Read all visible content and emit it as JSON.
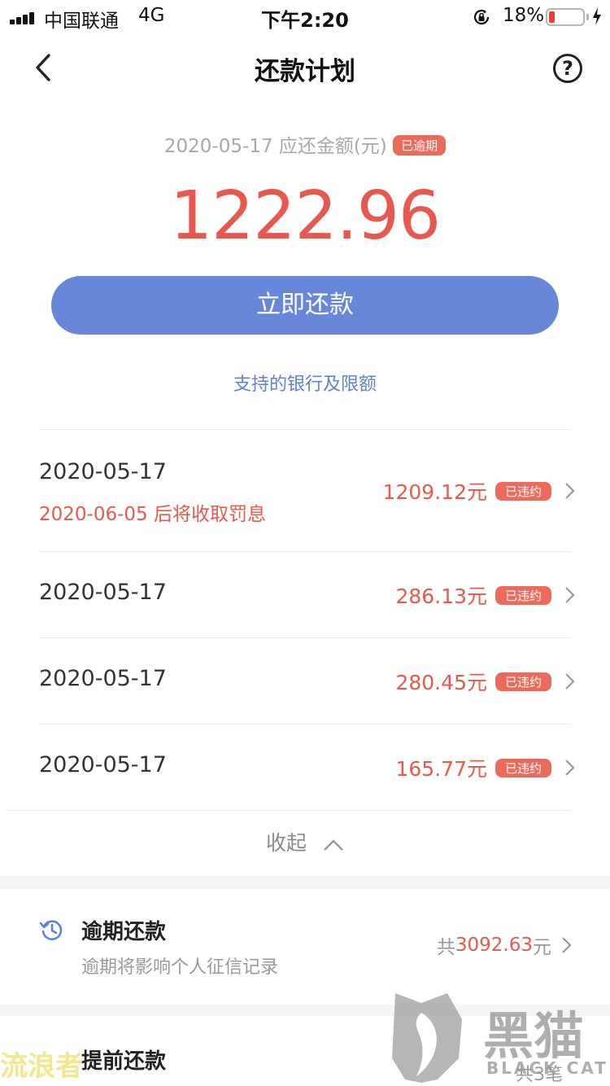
{
  "status_bar": {
    "carrier": "中国联通",
    "network": "4G",
    "time": "下午2:20",
    "battery_percent": "18%",
    "battery_level": 0.18
  },
  "nav": {
    "title": "还款计划",
    "help_glyph": "?"
  },
  "summary": {
    "due_label": "2020-05-17 应还金额(元)",
    "status_badge": "已逾期",
    "amount": "1222.96",
    "pay_button": "立即还款",
    "bank_link": "支持的银行及限额"
  },
  "installments": [
    {
      "date": "2020-05-17",
      "warning": "2020-06-05 后将收取罚息",
      "amount": "1209.12元",
      "badge": "已违约"
    },
    {
      "date": "2020-05-17",
      "amount": "286.13元",
      "badge": "已违约"
    },
    {
      "date": "2020-05-17",
      "amount": "280.45元",
      "badge": "已违约"
    },
    {
      "date": "2020-05-17",
      "amount": "165.77元",
      "badge": "已违约"
    }
  ],
  "collapse_label": "收起",
  "overdue_section": {
    "title": "逾期还款",
    "subtitle": "逾期将影响个人征信记录",
    "total_prefix": "共",
    "total_amount": "3092.63",
    "total_suffix": "元",
    "icon": "clock-history-icon"
  },
  "prepay_section": {
    "title": "提前还款",
    "count_text": "共3笔",
    "icon": "prepay-icon"
  },
  "watermarks": {
    "brand": "黑猫",
    "brand_en": "BLACK CAT",
    "corner_text": "流浪者"
  },
  "colors": {
    "accent_red": "#e8584c",
    "button_blue": "#6987d8",
    "link_blue": "#5f82cf"
  }
}
